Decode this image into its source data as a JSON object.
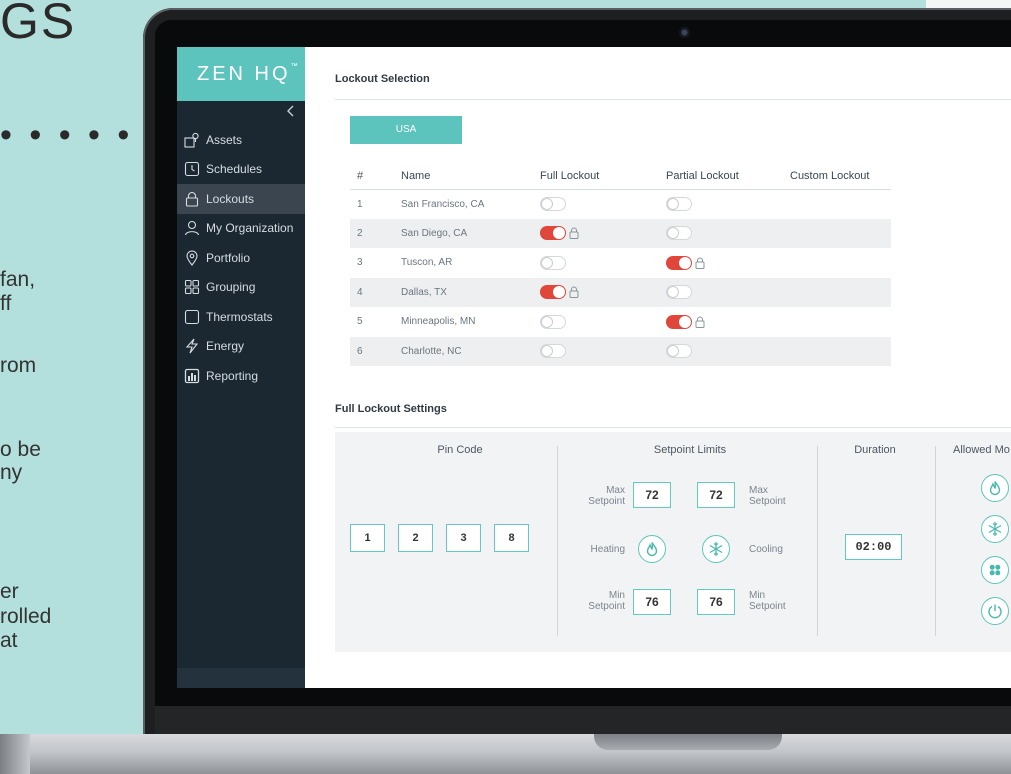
{
  "marketing": {
    "title": "GS",
    "dots": "• • • • •",
    "fragments": [
      "fan,",
      "ff",
      "rom",
      "o be",
      "ny",
      "er",
      "rolled",
      "at"
    ]
  },
  "brand": {
    "name": "ZEN HQ",
    "mark": "™"
  },
  "sidebar": {
    "collapse_icon": "chevron-left",
    "items": [
      {
        "label": "Assets",
        "icon": "assets-icon"
      },
      {
        "label": "Schedules",
        "icon": "clock-icon"
      },
      {
        "label": "Lockouts",
        "icon": "lock-icon",
        "active": true
      },
      {
        "label": "My Organization",
        "icon": "user-icon"
      },
      {
        "label": "Portfolio",
        "icon": "location-pin-icon"
      },
      {
        "label": "Grouping",
        "icon": "grid-icon"
      },
      {
        "label": "Thermostats",
        "icon": "thermostat-icon"
      },
      {
        "label": "Energy",
        "icon": "lightning-icon"
      },
      {
        "label": "Reporting",
        "icon": "bar-chart-icon"
      }
    ]
  },
  "lockout_selection": {
    "title": "Lockout Selection",
    "country_button": "USA",
    "columns": [
      "#",
      "Name",
      "Full Lockout",
      "Partial Lockout",
      "Custom Lockout"
    ],
    "rows": [
      {
        "num": "1",
        "name": "San Francisco, CA",
        "full": false,
        "partial": false
      },
      {
        "num": "2",
        "name": "San Diego, CA",
        "full": true,
        "partial": false
      },
      {
        "num": "3",
        "name": "Tuscon, AR",
        "full": false,
        "partial": true
      },
      {
        "num": "4",
        "name": "Dallas, TX",
        "full": true,
        "partial": false
      },
      {
        "num": "5",
        "name": "Minneapolis, MN",
        "full": false,
        "partial": true
      },
      {
        "num": "6",
        "name": "Charlotte, NC",
        "full": false,
        "partial": false
      }
    ]
  },
  "full_lockout_settings": {
    "title": "Full Lockout Settings",
    "pin_code_label": "Pin Code",
    "pin_digits": [
      "1",
      "2",
      "3",
      "8"
    ],
    "setpoint_limits_label": "Setpoint Limits",
    "max_setpoint_label": "Max\nSetpoint",
    "max_setpoint_label2": "Max\nSetpoint",
    "min_setpoint_label": "Min\nSetpoint",
    "min_setpoint_label2": "Min\nSetpoint",
    "heating_label": "Heating",
    "cooling_label": "Cooling",
    "heating_max": "72",
    "cooling_max": "72",
    "heating_min": "76",
    "cooling_min": "76",
    "duration_label": "Duration",
    "duration_value": "02:00",
    "allowed_modes_label": "Allowed Mo",
    "allowed_modes_icons": [
      "flame-icon",
      "snowflake-icon",
      "fan-icon",
      "power-icon"
    ]
  },
  "colors": {
    "accent": "#5cc4bd",
    "sidebar_bg": "#1b2731",
    "toggle_on": "#e0463a",
    "background": "#b3dfdc"
  }
}
